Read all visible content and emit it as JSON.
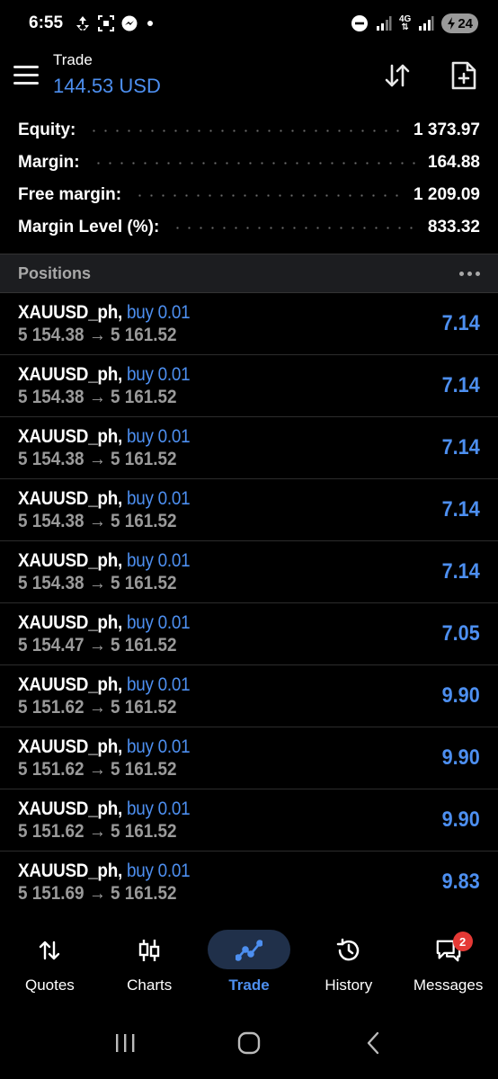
{
  "status_bar": {
    "time": "6:55",
    "network": "4G",
    "battery": "24"
  },
  "header": {
    "title": "Trade",
    "balance": "144.53 USD"
  },
  "summary": [
    {
      "label": "Equity:",
      "value": "1 373.97"
    },
    {
      "label": "Margin:",
      "value": "164.88"
    },
    {
      "label": "Free margin:",
      "value": "1 209.09"
    },
    {
      "label": "Margin Level (%):",
      "value": "833.32"
    }
  ],
  "positions": {
    "title": "Positions",
    "items": [
      {
        "symbol": "XAUUSD_ph,",
        "side": "buy 0.01",
        "prices": "5 154.38 → 5 161.52",
        "profit": "7.14"
      },
      {
        "symbol": "XAUUSD_ph,",
        "side": "buy 0.01",
        "prices": "5 154.38 → 5 161.52",
        "profit": "7.14"
      },
      {
        "symbol": "XAUUSD_ph,",
        "side": "buy 0.01",
        "prices": "5 154.38 → 5 161.52",
        "profit": "7.14"
      },
      {
        "symbol": "XAUUSD_ph,",
        "side": "buy 0.01",
        "prices": "5 154.38 → 5 161.52",
        "profit": "7.14"
      },
      {
        "symbol": "XAUUSD_ph,",
        "side": "buy 0.01",
        "prices": "5 154.38 → 5 161.52",
        "profit": "7.14"
      },
      {
        "symbol": "XAUUSD_ph,",
        "side": "buy 0.01",
        "prices": "5 154.47 → 5 161.52",
        "profit": "7.05"
      },
      {
        "symbol": "XAUUSD_ph,",
        "side": "buy 0.01",
        "prices": "5 151.62 → 5 161.52",
        "profit": "9.90"
      },
      {
        "symbol": "XAUUSD_ph,",
        "side": "buy 0.01",
        "prices": "5 151.62 → 5 161.52",
        "profit": "9.90"
      },
      {
        "symbol": "XAUUSD_ph,",
        "side": "buy 0.01",
        "prices": "5 151.62 → 5 161.52",
        "profit": "9.90"
      },
      {
        "symbol": "XAUUSD_ph,",
        "side": "buy 0.01",
        "prices": "5 151.69 → 5 161.52",
        "profit": "9.83"
      }
    ]
  },
  "bottom_nav": [
    {
      "label": "Quotes",
      "icon": "quotes-icon",
      "active": false
    },
    {
      "label": "Charts",
      "icon": "charts-icon",
      "active": false
    },
    {
      "label": "Trade",
      "icon": "trade-icon",
      "active": true
    },
    {
      "label": "History",
      "icon": "history-icon",
      "active": false
    },
    {
      "label": "Messages",
      "icon": "messages-icon",
      "active": false,
      "badge": "2"
    }
  ],
  "colors": {
    "accent": "#4d8ff0",
    "muted": "#9a9a9a",
    "badge": "#e53935",
    "active_pill": "#20304a"
  }
}
